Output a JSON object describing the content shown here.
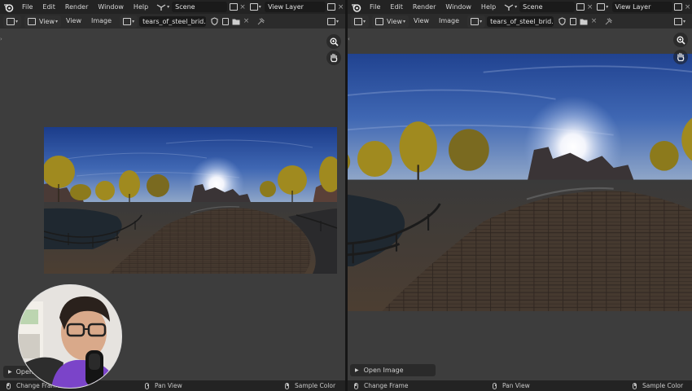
{
  "menus": [
    "File",
    "Edit",
    "Render",
    "Window",
    "Help"
  ],
  "scene": {
    "label": "Scene"
  },
  "view_layer": {
    "label": "View Layer"
  },
  "header": {
    "view_menu": "View",
    "view_button": "View",
    "image_button": "Image",
    "image_name": "tears_of_steel_brid..."
  },
  "open_image": "Open Image",
  "open_image_left": "Open I",
  "status": {
    "change_frame": "Change Frame",
    "pan_view": "Pan View",
    "sample_color": "Sample Color"
  },
  "icons": [
    "blender-logo-icon",
    "image-editor-icon",
    "view-icon",
    "image-icon",
    "shield-icon",
    "duplicate-icon",
    "folder-icon",
    "close-icon",
    "pin-icon",
    "zoom-icon",
    "hand-icon",
    "collapse-arrow-icon",
    "mouse-left-icon",
    "mouse-middle-icon",
    "mouse-right-icon"
  ],
  "colors": {
    "topbar": "#232323",
    "header": "#2b2b2b",
    "area": "#3d3d3d",
    "field": "#1a1a1a",
    "text": "#d6d6d6"
  }
}
